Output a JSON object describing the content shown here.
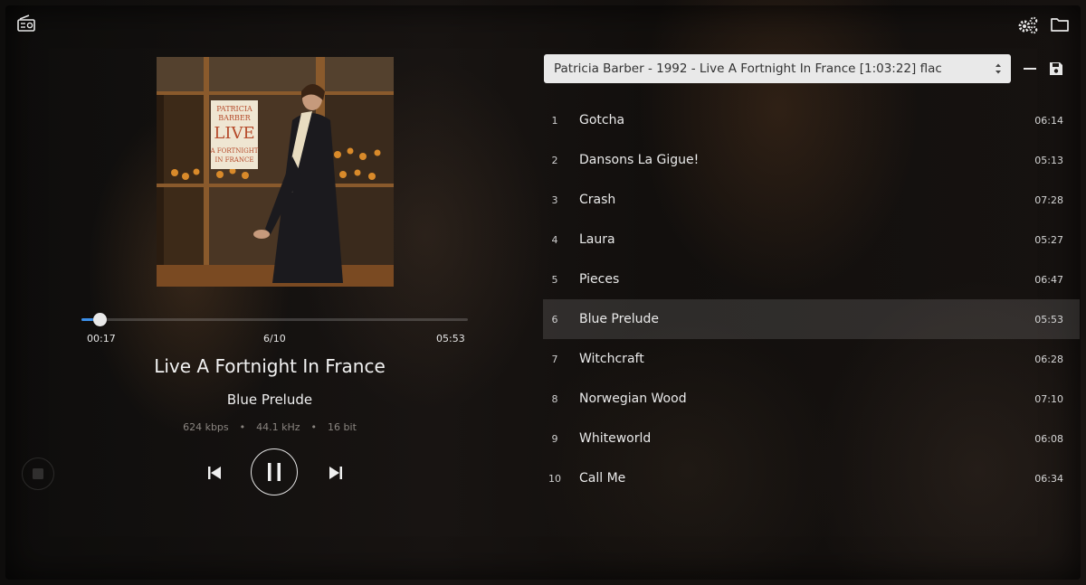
{
  "header": {
    "radio_icon": "radio-icon",
    "settings_icon": "gears-icon",
    "folder_icon": "folder-icon"
  },
  "player": {
    "elapsed": "00:17",
    "position": "6/10",
    "duration": "05:53",
    "progress_fraction": 0.048,
    "album": "Live A Fortnight In France",
    "track": "Blue Prelude",
    "bitrate": "624 kbps",
    "samplerate": "44.1 kHz",
    "bitdepth": "16 bit",
    "sep": "•"
  },
  "cover": {
    "line1": "PATRICIA",
    "line2": "BARBER",
    "line3": "LIVE",
    "line4": "A FORTNIGHT",
    "line5": "IN FRANCE"
  },
  "playlist": {
    "selected": "Patricia Barber - 1992 - Live A Fortnight In France [1:03:22] flac",
    "active_index": 5,
    "tracks": [
      {
        "num": "1",
        "title": "Gotcha",
        "dur": "06:14"
      },
      {
        "num": "2",
        "title": "Dansons La Gigue!",
        "dur": "05:13"
      },
      {
        "num": "3",
        "title": "Crash",
        "dur": "07:28"
      },
      {
        "num": "4",
        "title": "Laura",
        "dur": "05:27"
      },
      {
        "num": "5",
        "title": "Pieces",
        "dur": "06:47"
      },
      {
        "num": "6",
        "title": "Blue Prelude",
        "dur": "05:53"
      },
      {
        "num": "7",
        "title": "Witchcraft",
        "dur": "06:28"
      },
      {
        "num": "8",
        "title": "Norwegian Wood",
        "dur": "07:10"
      },
      {
        "num": "9",
        "title": "Whiteworld",
        "dur": "06:08"
      },
      {
        "num": "10",
        "title": "Call Me",
        "dur": "06:34"
      }
    ]
  },
  "colors": {
    "accent": "#3b8ee8",
    "active_row": "rgba(255,255,255,0.12)"
  }
}
